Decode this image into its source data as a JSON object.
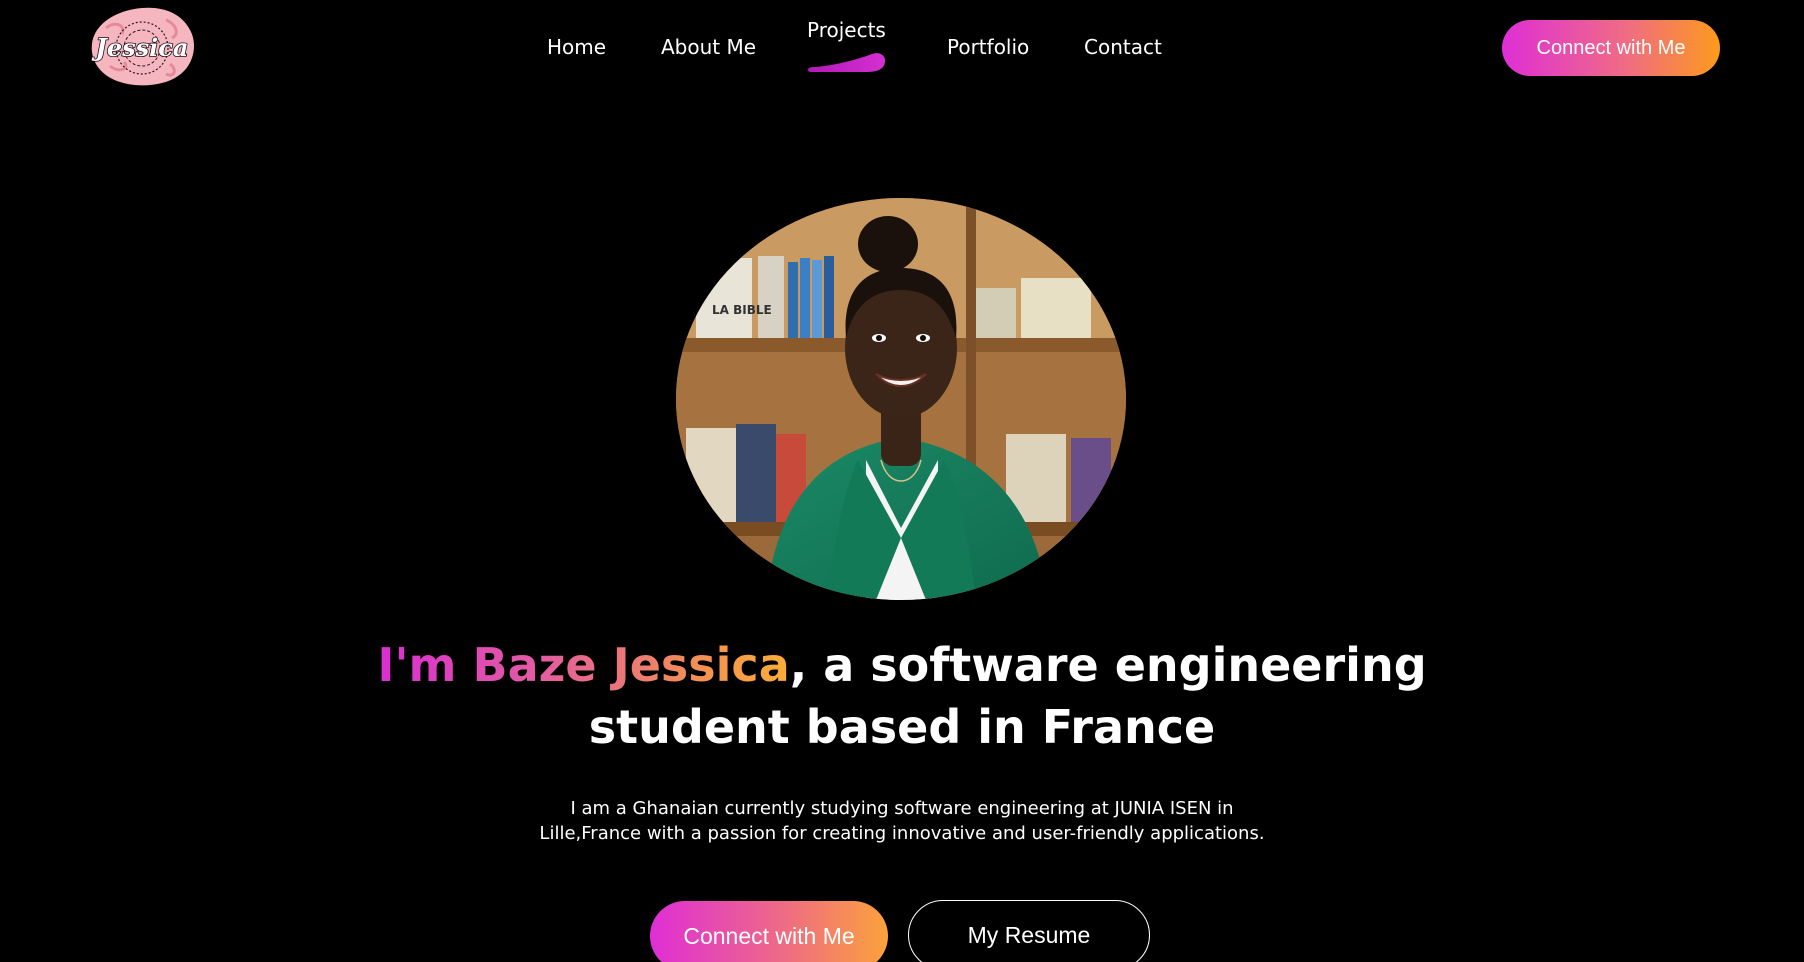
{
  "header": {
    "logo_text": "Jessica",
    "nav": [
      {
        "label": "Home",
        "active": false
      },
      {
        "label": "About Me",
        "active": false
      },
      {
        "label": "Projects",
        "active": true
      },
      {
        "label": "Portfolio",
        "active": false
      },
      {
        "label": "Contact",
        "active": false
      }
    ],
    "cta_label": "Connect with Me"
  },
  "hero": {
    "name_highlight": "I'm Baze Jessica",
    "headline_rest_line1": ", a software engineering",
    "headline_line2": "student based in France",
    "intro_line1": "I am a Ghanaian currently studying software engineering at JUNIA ISEN in",
    "intro_line2": "Lille,France with a passion for creating innovative and user-friendly applications.",
    "primary_button": "Connect with Me",
    "secondary_button": "My Resume"
  },
  "colors": {
    "background": "#000000",
    "gradient_start": "#df2ed6",
    "gradient_end": "#fd9a1c",
    "text": "#ffffff"
  }
}
